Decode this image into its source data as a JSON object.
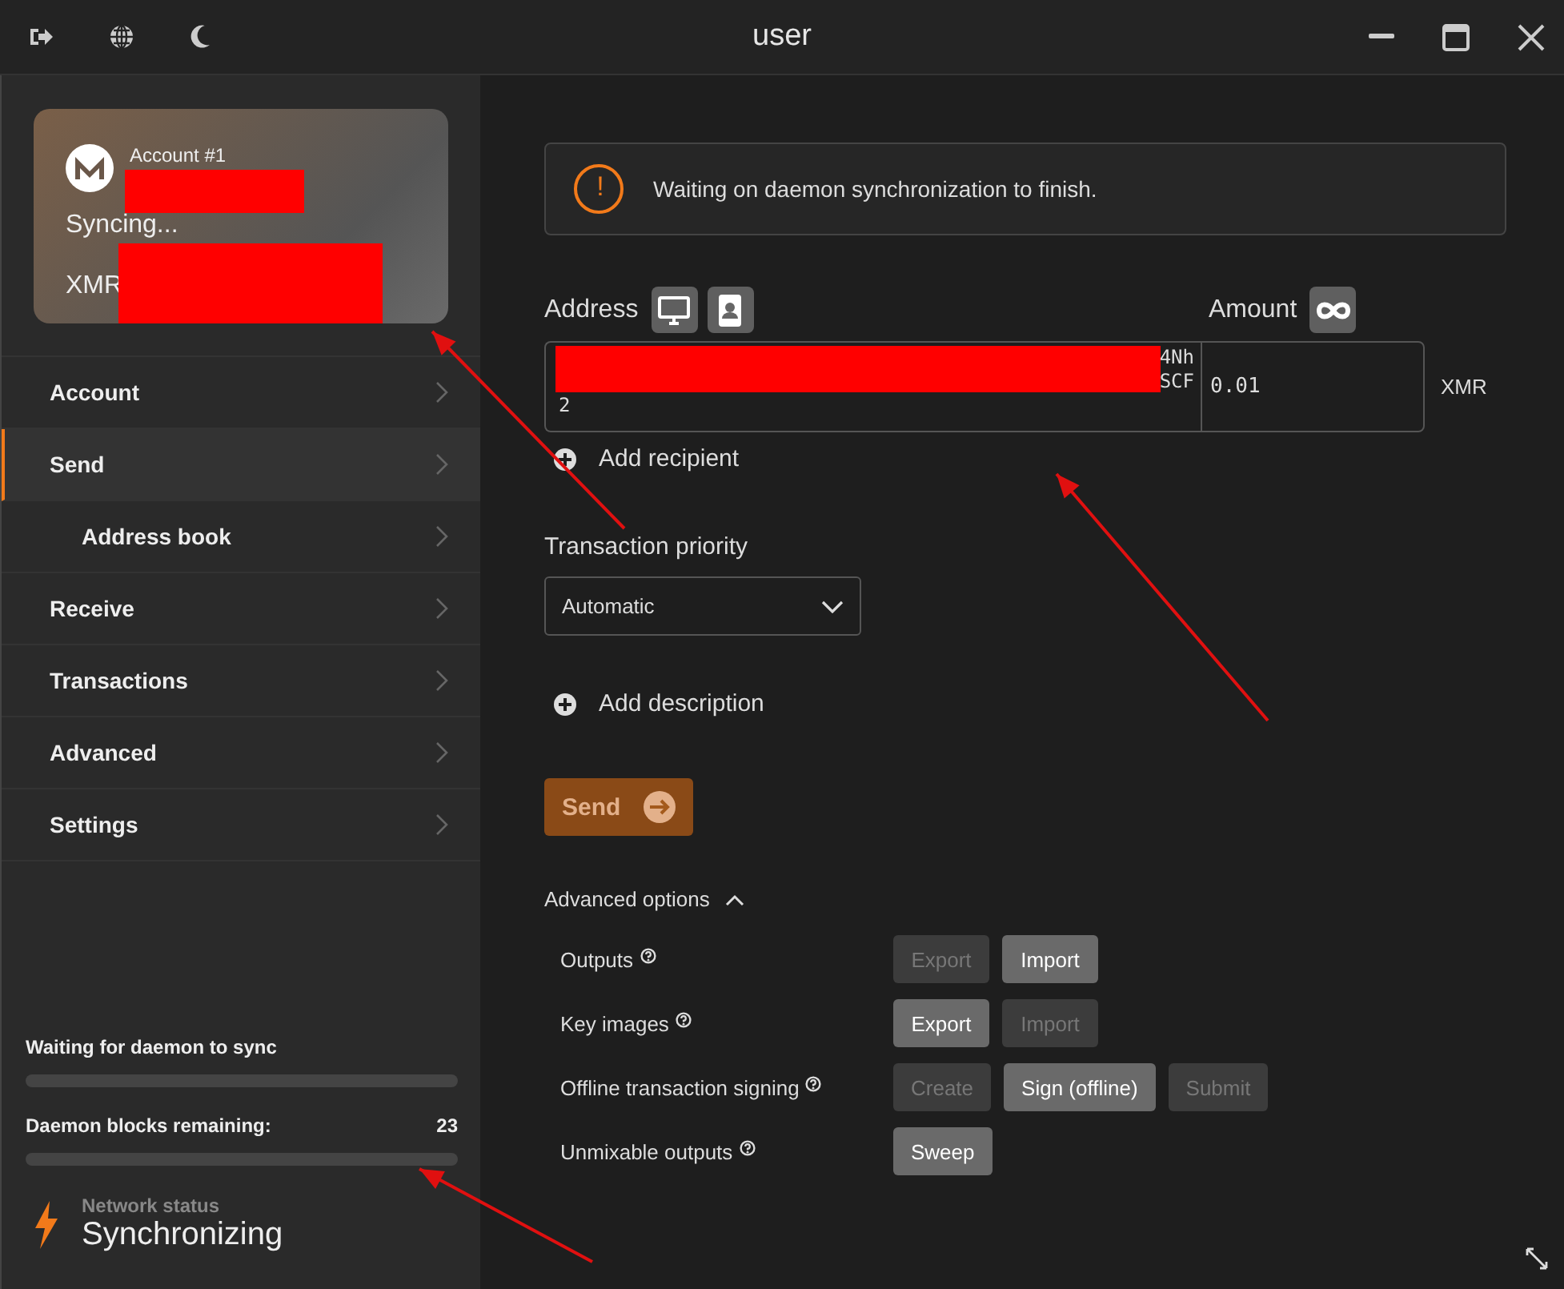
{
  "window": {
    "title": "user"
  },
  "account_card": {
    "account": "Account #1",
    "status": "Syncing...",
    "currency": "XMR"
  },
  "sidebar": {
    "items": [
      {
        "label": "Account",
        "selected": false
      },
      {
        "label": "Send",
        "selected": true,
        "children": [
          {
            "label": "Address book",
            "selected": false
          }
        ]
      },
      {
        "label": "Receive",
        "selected": false
      },
      {
        "label": "Transactions",
        "selected": false
      },
      {
        "label": "Advanced",
        "selected": false
      },
      {
        "label": "Settings",
        "selected": false
      }
    ]
  },
  "sync": {
    "waiting": {
      "label": "Waiting for daemon to sync",
      "level": 0
    },
    "blocks": {
      "label": "Daemon blocks remaining:",
      "count": "23",
      "level": 0
    }
  },
  "network": {
    "label": "Network status",
    "status": "Synchronizing"
  },
  "notice": {
    "icon": "!",
    "text": "Waiting on daemon synchronization to finish."
  },
  "form": {
    "address_label": "Address",
    "amount_label": "Amount",
    "address_lines": [
      "4Nh",
      "SCF",
      "2"
    ],
    "amount": "0.01",
    "currency": "XMR",
    "add_recipient": "Add recipient",
    "priority_label": "Transaction priority",
    "priority": "Automatic",
    "add_description": "Add description",
    "send": {
      "label": "Send",
      "disabled": true
    }
  },
  "advanced": {
    "title": "Advanced options",
    "expanded": true,
    "rows": [
      {
        "label": "Outputs",
        "buttons": [
          {
            "label": "Export",
            "disabled": true
          },
          {
            "label": "Import",
            "disabled": false
          }
        ]
      },
      {
        "label": "Key images",
        "buttons": [
          {
            "label": "Export",
            "disabled": false
          },
          {
            "label": "Import",
            "disabled": true
          }
        ]
      },
      {
        "label": "Offline transaction signing",
        "buttons": [
          {
            "label": "Create",
            "disabled": true
          },
          {
            "label": "Sign (offline)",
            "disabled": false
          },
          {
            "label": "Submit",
            "disabled": true
          }
        ]
      },
      {
        "label": "Unmixable outputs",
        "buttons": [
          {
            "label": "Sweep",
            "disabled": false
          }
        ]
      }
    ]
  }
}
